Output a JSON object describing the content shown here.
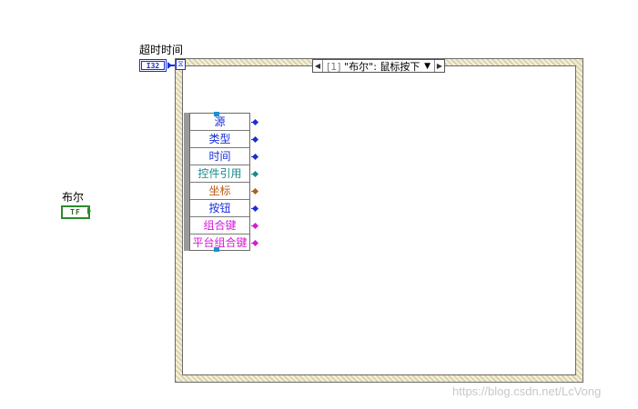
{
  "timeout": {
    "label": "超时时间",
    "terminal": "I32"
  },
  "boolean": {
    "label": "布尔",
    "terminal": "TF"
  },
  "event_structure": {
    "hourglass_icon": "hourglass-icon",
    "selector": {
      "index": "[1]",
      "text": "\"布尔\": 鼠标按下"
    }
  },
  "event_data": [
    {
      "label": "源",
      "color": "#1a2ed6"
    },
    {
      "label": "类型",
      "color": "#1a2ed6"
    },
    {
      "label": "时间",
      "color": "#1a2ed6"
    },
    {
      "label": "控件引用",
      "color": "#1a8a8a"
    },
    {
      "label": "坐标",
      "color": "#b85a14"
    },
    {
      "label": "按钮",
      "color": "#1a2ed6"
    },
    {
      "label": "组合键",
      "color": "#d81ad8"
    },
    {
      "label": "平台组合键",
      "color": "#d81ad8"
    }
  ],
  "watermark": "https://blog.csdn.net/LcVong"
}
